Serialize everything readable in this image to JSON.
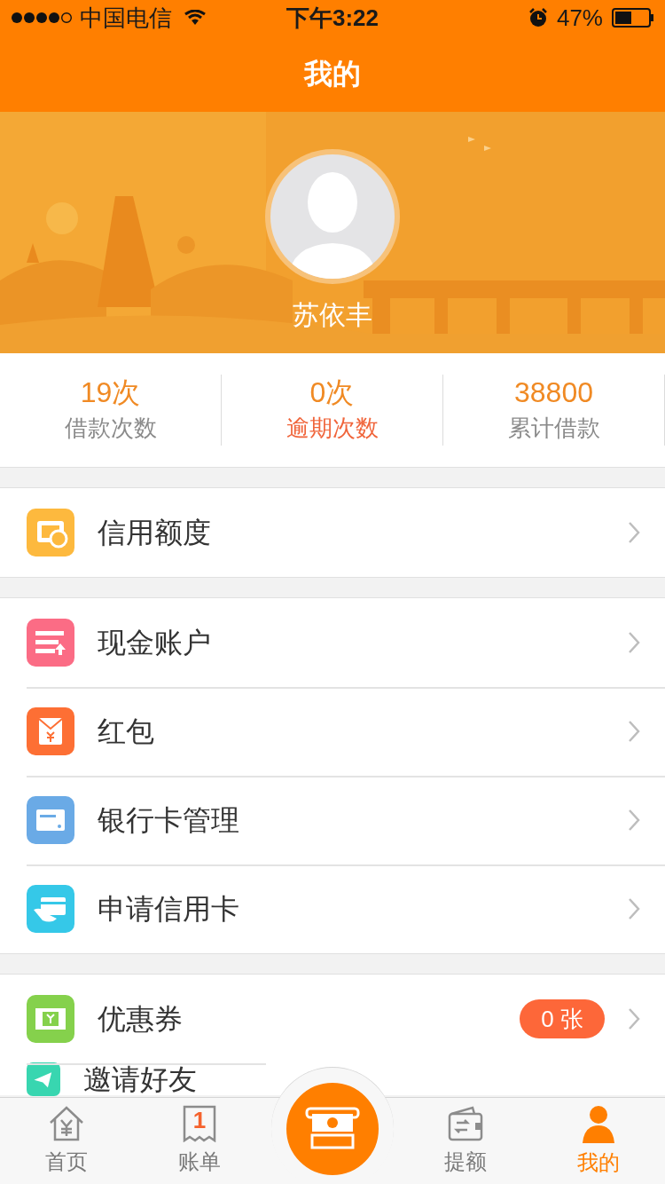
{
  "status_bar": {
    "carrier": "中国电信",
    "time": "下午3:22",
    "battery": "47%"
  },
  "nav": {
    "title": "我的"
  },
  "profile": {
    "name": "苏依丰"
  },
  "stats": [
    {
      "value": "19次",
      "label": "借款次数",
      "highlighted": false
    },
    {
      "value": "0次",
      "label": "逾期次数",
      "highlighted": true
    },
    {
      "value": "38800",
      "label": "累计借款",
      "highlighted": false
    }
  ],
  "groups": [
    [
      {
        "label": "信用额度",
        "kind": "credit",
        "color": "#fdb93e"
      }
    ],
    [
      {
        "label": "现金账户",
        "kind": "cash",
        "color": "#fb6c85"
      },
      {
        "label": "红包",
        "kind": "redpacket",
        "color": "#fd6f34"
      },
      {
        "label": "银行卡管理",
        "kind": "bankcard",
        "color": "#6aaae6"
      },
      {
        "label": "申请信用卡",
        "kind": "creditcard",
        "color": "#35c8e8"
      }
    ],
    [
      {
        "label": "优惠券",
        "kind": "coupon",
        "color": "#85d14c",
        "badge": "0 张"
      },
      {
        "label": "邀请好友",
        "kind": "invite",
        "color": "#38d6b0"
      }
    ]
  ],
  "tabs": [
    {
      "label": "首页",
      "kind": "home",
      "selected": false
    },
    {
      "label": "账单",
      "kind": "bill",
      "selected": false,
      "badge": "1"
    },
    {
      "kind": "center"
    },
    {
      "label": "提额",
      "kind": "wallet",
      "selected": false
    },
    {
      "label": "我的",
      "kind": "me",
      "selected": true
    }
  ]
}
